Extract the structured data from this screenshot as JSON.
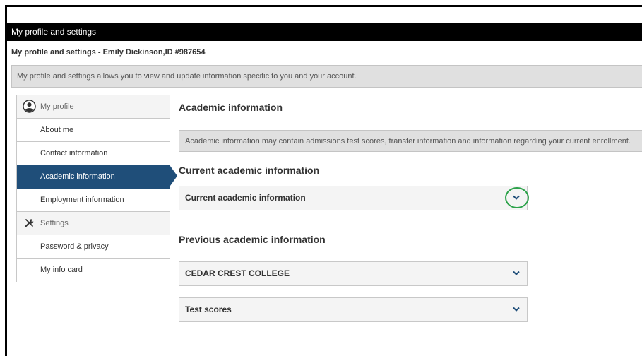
{
  "header": {
    "title": "My profile and settings",
    "subtitle": "My profile and settings - Emily Dickinson,ID #987654",
    "description": "My profile and settings allows you to view and update information specific to you and your account."
  },
  "sidebar": {
    "profile_section": "My profile",
    "items": [
      {
        "label": "About me"
      },
      {
        "label": "Contact information"
      },
      {
        "label": "Academic information",
        "active": true
      },
      {
        "label": "Employment information"
      }
    ],
    "settings_section": "Settings",
    "settings_items": [
      {
        "label": "Password & privacy"
      },
      {
        "label": "My info card"
      }
    ]
  },
  "main": {
    "heading": "Academic information",
    "description": "Academic information may contain admissions test scores, transfer information and information regarding your current enrollment.",
    "current": {
      "heading": "Current academic information",
      "accordion_label": "Current academic information"
    },
    "previous": {
      "heading": "Previous academic information",
      "accordions": [
        {
          "label": "CEDAR CREST COLLEGE"
        },
        {
          "label": "Test scores"
        }
      ]
    }
  },
  "colors": {
    "active_nav": "#1f4e79",
    "highlight_ring": "#2ca24a",
    "chevron": "#1f4e79"
  }
}
